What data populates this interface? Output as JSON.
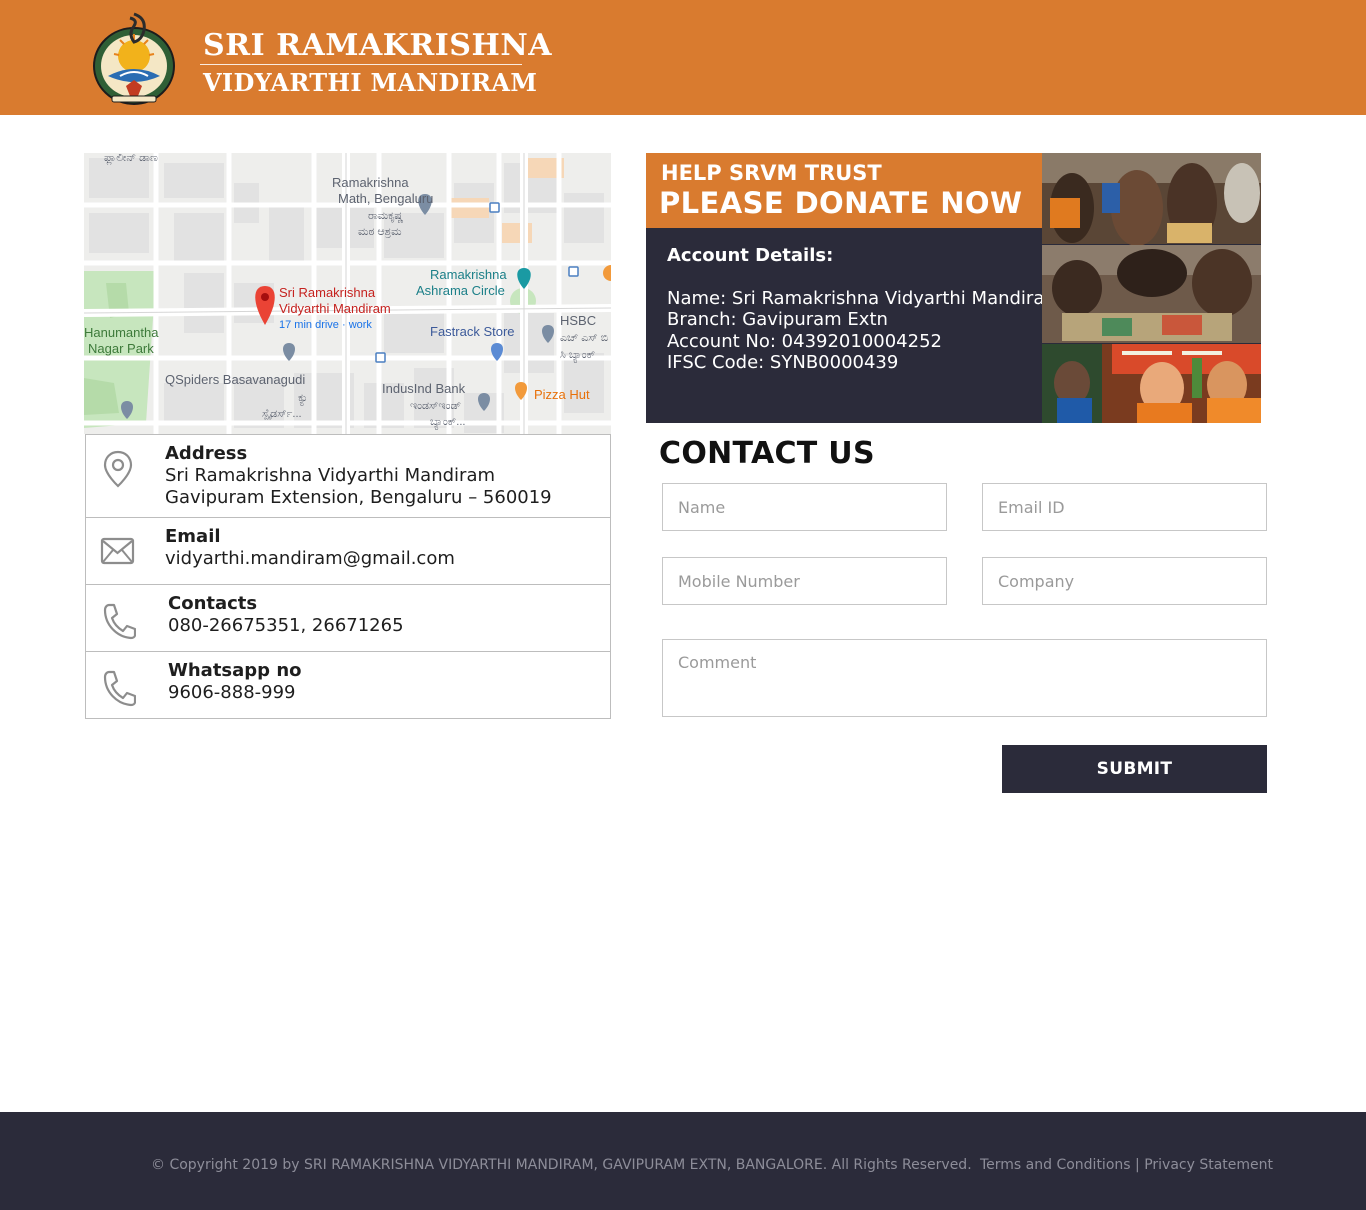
{
  "header": {
    "brand_line1": "SRI RAMAKRISHNA",
    "brand_line2": "VIDYARTHI MANDIRAM",
    "logo_icon": "ramakrishna-emblem-icon",
    "background": "#d97b2f"
  },
  "map": {
    "labels": {
      "top_left_kannada": "ಫ್ಲಾಲೀನ್ ಡಾಣ",
      "math_line1": "Ramakrishna",
      "math_line2": "Math, Bengaluru",
      "math_kn1": "ರಾಮಕೃಷ್ಣ",
      "math_kn2": "ಮಠ ಆಶ್ರಮ",
      "circle_line1": "Ramakrishna",
      "circle_line2": "Ashrama Circle",
      "pin_line1": "Sri Ramakrishna",
      "pin_line2": "Vidyarthi Mandiram",
      "pin_sub": "17 min drive · work",
      "park_line1": "Hanumantha",
      "park_line2": "Nagar Park",
      "fastrack": "Fastrack Store",
      "hsbc": "HSBC",
      "hsbc_kn1": "ಎಚ್ ಎಸ್ ಬಿ",
      "hsbc_kn2": "ಸಿ ಬ್ಯಾಂಕ್",
      "qspiders": "QSpiders Basavanagudi",
      "qspiders_kn1": "ಕ್ಯು",
      "qspiders_kn2": "ಸ್ಪೈಡರ್ಸ್...",
      "indusind": "IndusInd Bank",
      "indusind_kn1": "ಇಂಡಸ್ಇಂಡ್",
      "indusind_kn2": "ಬ್ಯಾಂಕ್...",
      "pizza": "Pizza Hut"
    }
  },
  "info": {
    "address": {
      "title": "Address",
      "line1": "Sri Ramakrishna Vidyarthi Mandiram",
      "line2": "Gavipuram Extension, Bengaluru – 560019",
      "icon": "location-pin-icon"
    },
    "email": {
      "title": "Email",
      "value": "vidyarthi.mandiram@gmail.com",
      "icon": "envelope-icon"
    },
    "contacts": {
      "title": "Contacts",
      "value": "080-26675351, 26671265",
      "icon": "phone-icon"
    },
    "whatsapp": {
      "title": "Whatsapp no",
      "value": "9606-888-999",
      "icon": "phone-icon"
    }
  },
  "donate": {
    "heading_small": "HELP SRVM TRUST",
    "heading_large": "PLEASE DONATE NOW",
    "account_title": "Account Details:",
    "name": "Name: Sri Ramakrishna Vidyarthi Mandiram",
    "branch": "Branch: Gavipuram Extn",
    "account_no": "Account No: 04392010004252",
    "ifsc": "IFSC Code: SYNB0000439",
    "accent": "#d97b2f",
    "panel_bg": "#2b2b3a"
  },
  "contact_form": {
    "title": "CONTACT US",
    "name_placeholder": "Name",
    "email_placeholder": "Email ID",
    "mobile_placeholder": "Mobile Number",
    "company_placeholder": "Company",
    "comment_placeholder": "Comment",
    "submit_label": "SUBMIT"
  },
  "footer": {
    "copyright": "© Copyright 2019 by SRI RAMAKRISHNA VIDYARTHI MANDIRAM, GAVIPURAM EXTN, BANGALORE. All Rights Reserved.",
    "terms": "Terms and Conditions",
    "separator": "|",
    "privacy": "Privacy Statement",
    "background": "#2b2b3a"
  }
}
